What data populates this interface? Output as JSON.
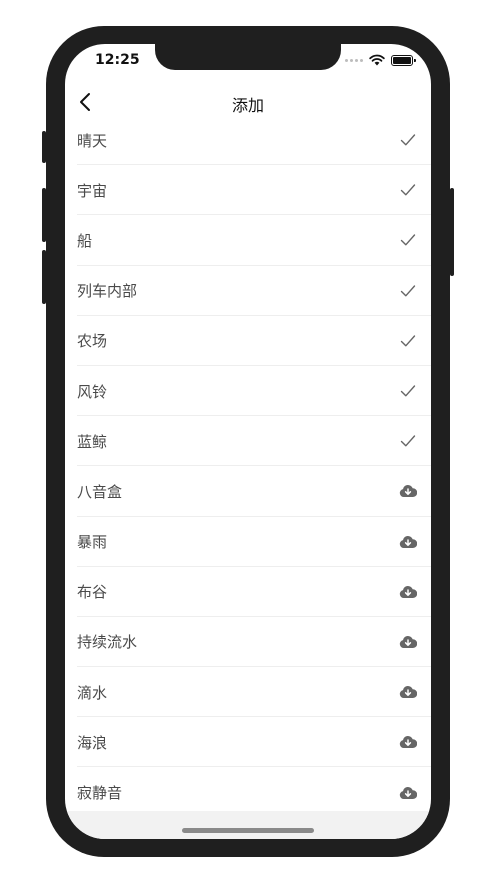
{
  "status": {
    "time": "12:25"
  },
  "nav": {
    "title": "添加"
  },
  "items": [
    {
      "label": "晴天",
      "state": "check-icon"
    },
    {
      "label": "宇宙",
      "state": "check-icon"
    },
    {
      "label": "船",
      "state": "check-icon"
    },
    {
      "label": "列车内部",
      "state": "check-icon"
    },
    {
      "label": "农场",
      "state": "check-icon"
    },
    {
      "label": "风铃",
      "state": "check-icon"
    },
    {
      "label": "蓝鲸",
      "state": "check-icon"
    },
    {
      "label": "八音盒",
      "state": "cloud-download-icon"
    },
    {
      "label": "暴雨",
      "state": "cloud-download-icon"
    },
    {
      "label": "布谷",
      "state": "cloud-download-icon"
    },
    {
      "label": "持续流水",
      "state": "cloud-download-icon"
    },
    {
      "label": "滴水",
      "state": "cloud-download-icon"
    },
    {
      "label": "海浪",
      "state": "cloud-download-icon"
    },
    {
      "label": "寂静音",
      "state": "cloud-download-icon"
    }
  ],
  "colors": {
    "icon": "#666666",
    "text": "#4a4a4a",
    "frame": "#1f1f1f"
  }
}
